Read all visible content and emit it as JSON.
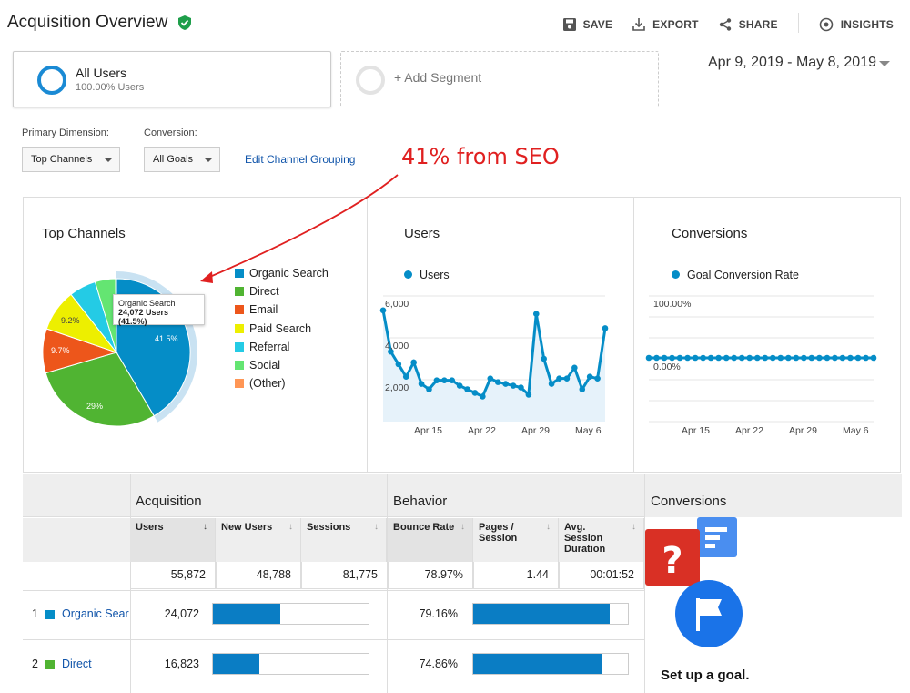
{
  "header": {
    "title": "Acquisition Overview",
    "actions": [
      {
        "label": "SAVE",
        "icon": "save-icon"
      },
      {
        "label": "EXPORT",
        "icon": "export-icon"
      },
      {
        "label": "SHARE",
        "icon": "share-icon"
      },
      {
        "label": "INSIGHTS",
        "icon": "insights-icon"
      }
    ]
  },
  "segments": {
    "all_users": {
      "name": "All Users",
      "sub": "100.00% Users"
    },
    "add_label": "+ Add Segment"
  },
  "date_range": "Apr 9, 2019 - May 8, 2019",
  "controls": {
    "primary_dimension_label": "Primary Dimension:",
    "primary_dimension_value": "Top Channels",
    "conversion_label": "Conversion:",
    "conversion_value": "All Goals",
    "edit_link": "Edit Channel Grouping"
  },
  "annotation": "41% from SEO",
  "top_channels": {
    "title": "Top Channels",
    "tooltip": {
      "name": "Organic Search",
      "value": "24,072 Users (41.5%)"
    },
    "legend": [
      {
        "label": "Organic Search",
        "color": "#058dc7"
      },
      {
        "label": "Direct",
        "color": "#50b432"
      },
      {
        "label": "Email",
        "color": "#ed561b"
      },
      {
        "label": "Paid Search",
        "color": "#edef00"
      },
      {
        "label": "Referral",
        "color": "#24cbe5"
      },
      {
        "label": "Social",
        "color": "#64e572"
      },
      {
        "label": "(Other)",
        "color": "#ff9655"
      }
    ],
    "slice_labels": {
      "organic": "41.5%",
      "direct": "29%",
      "email": "9.7%",
      "paid": "9.2%"
    }
  },
  "users_chart": {
    "title": "Users",
    "series_label": "Users",
    "y_ticks": [
      "6,000",
      "4,000",
      "2,000"
    ],
    "x_ticks": [
      "Apr 15",
      "Apr 22",
      "Apr 29",
      "May 6"
    ]
  },
  "conversions_chart": {
    "title": "Conversions",
    "series_label": "Goal Conversion Rate",
    "y_ticks": [
      "100.00%",
      "0.00%"
    ],
    "x_ticks": [
      "Apr 15",
      "Apr 22",
      "Apr 29",
      "May 6"
    ]
  },
  "chart_data": [
    {
      "type": "pie",
      "title": "Top Channels",
      "categories": [
        "Organic Search",
        "Direct",
        "Email",
        "Paid Search",
        "Referral",
        "Social",
        "(Other)"
      ],
      "values": [
        41.5,
        29.0,
        9.7,
        9.2,
        5.9,
        4.5,
        0.2
      ]
    },
    {
      "type": "line",
      "title": "Users",
      "x": [
        "Apr 9",
        "Apr 10",
        "Apr 11",
        "Apr 12",
        "Apr 13",
        "Apr 14",
        "Apr 15",
        "Apr 16",
        "Apr 17",
        "Apr 18",
        "Apr 19",
        "Apr 20",
        "Apr 21",
        "Apr 22",
        "Apr 23",
        "Apr 24",
        "Apr 25",
        "Apr 26",
        "Apr 27",
        "Apr 28",
        "Apr 29",
        "Apr 30",
        "May 1",
        "May 2",
        "May 3",
        "May 4",
        "May 5",
        "May 6",
        "May 7",
        "May 8"
      ],
      "series": [
        {
          "name": "Users",
          "values": [
            6200,
            3900,
            3200,
            2500,
            3300,
            2100,
            1800,
            2300,
            2300,
            2300,
            2000,
            1800,
            1600,
            1400,
            2400,
            2200,
            2100,
            2000,
            1900,
            1500,
            6000,
            3500,
            2100,
            2400,
            2400,
            3000,
            1800,
            2500,
            2400,
            5200
          ]
        }
      ],
      "ylim": [
        0,
        7000
      ]
    },
    {
      "type": "line",
      "title": "Conversions",
      "x": [
        "Apr 9",
        "Apr 10",
        "Apr 11",
        "Apr 12",
        "Apr 13",
        "Apr 14",
        "Apr 15",
        "Apr 16",
        "Apr 17",
        "Apr 18",
        "Apr 19",
        "Apr 20",
        "Apr 21",
        "Apr 22",
        "Apr 23",
        "Apr 24",
        "Apr 25",
        "Apr 26",
        "Apr 27",
        "Apr 28",
        "Apr 29",
        "Apr 30",
        "May 1",
        "May 2",
        "May 3",
        "May 4",
        "May 5",
        "May 6",
        "May 7",
        "May 8"
      ],
      "series": [
        {
          "name": "Goal Conversion Rate",
          "values": [
            0,
            0,
            0,
            0,
            0,
            0,
            0,
            0,
            0,
            0,
            0,
            0,
            0,
            0,
            0,
            0,
            0,
            0,
            0,
            0,
            0,
            0,
            0,
            0,
            0,
            0,
            0,
            0,
            0,
            0
          ]
        }
      ],
      "ylim": [
        0,
        100
      ]
    }
  ],
  "table": {
    "groups": {
      "acquisition": "Acquisition",
      "behavior": "Behavior",
      "conversions": "Conversions"
    },
    "columns": [
      "Users",
      "New Users",
      "Sessions",
      "Bounce Rate",
      "Pages / Session",
      "Avg. Session Duration"
    ],
    "totals": [
      "55,872",
      "48,788",
      "81,775",
      "78.97%",
      "1.44",
      "00:01:52"
    ],
    "rows": [
      {
        "rank": "1",
        "channel": "Organic Sear",
        "color": "#058dc7",
        "users": "24,072",
        "users_share": 0.43,
        "bounce": "79.16%",
        "bounce_share": 0.88
      },
      {
        "rank": "2",
        "channel": "Direct",
        "color": "#50b432",
        "users": "16,823",
        "users_share": 0.3,
        "bounce": "74.86%",
        "bounce_share": 0.83
      }
    ],
    "setup_goal": "Set up a goal."
  }
}
